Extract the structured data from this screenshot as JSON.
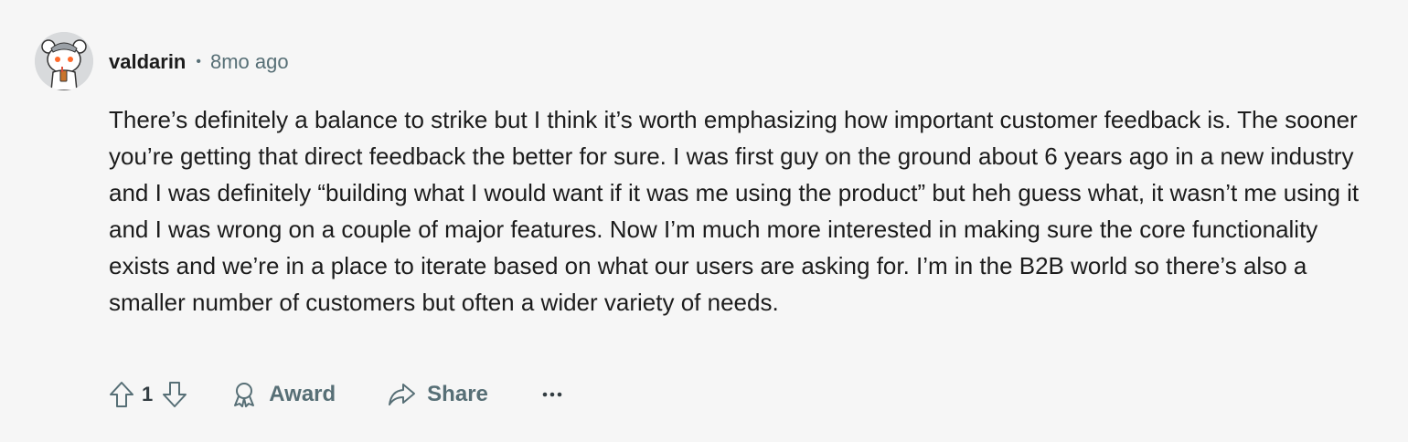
{
  "comment": {
    "author": "valdarin",
    "separator": "•",
    "timestamp": "8mo ago",
    "body": "There’s definitely a balance to strike but I think it’s worth emphasizing how important customer feedback is. The sooner you’re getting that direct feedback the better for sure. I was first guy on the ground about 6 years ago in a new industry and I was definitely “building what I would want if it was me using the product” but heh guess what, it wasn’t me using it and I was wrong on a couple of major features. Now I’m much more interested in making sure the core functionality exists and we’re in a place to iterate based on what our users are asking for. I’m in the B2B world so there’s also a smaller number of customers but often a wider variety of needs.",
    "score": "1"
  },
  "actions": {
    "award_label": "Award",
    "share_label": "Share"
  },
  "icons": {
    "upvote": "arrow-up-outline-icon",
    "downvote": "arrow-down-outline-icon",
    "award": "award-ribbon-icon",
    "share": "share-arrow-icon",
    "more": "ellipsis-icon"
  },
  "colors": {
    "background": "#f6f6f6",
    "text": "#1c1c1c",
    "muted": "#576f76"
  }
}
